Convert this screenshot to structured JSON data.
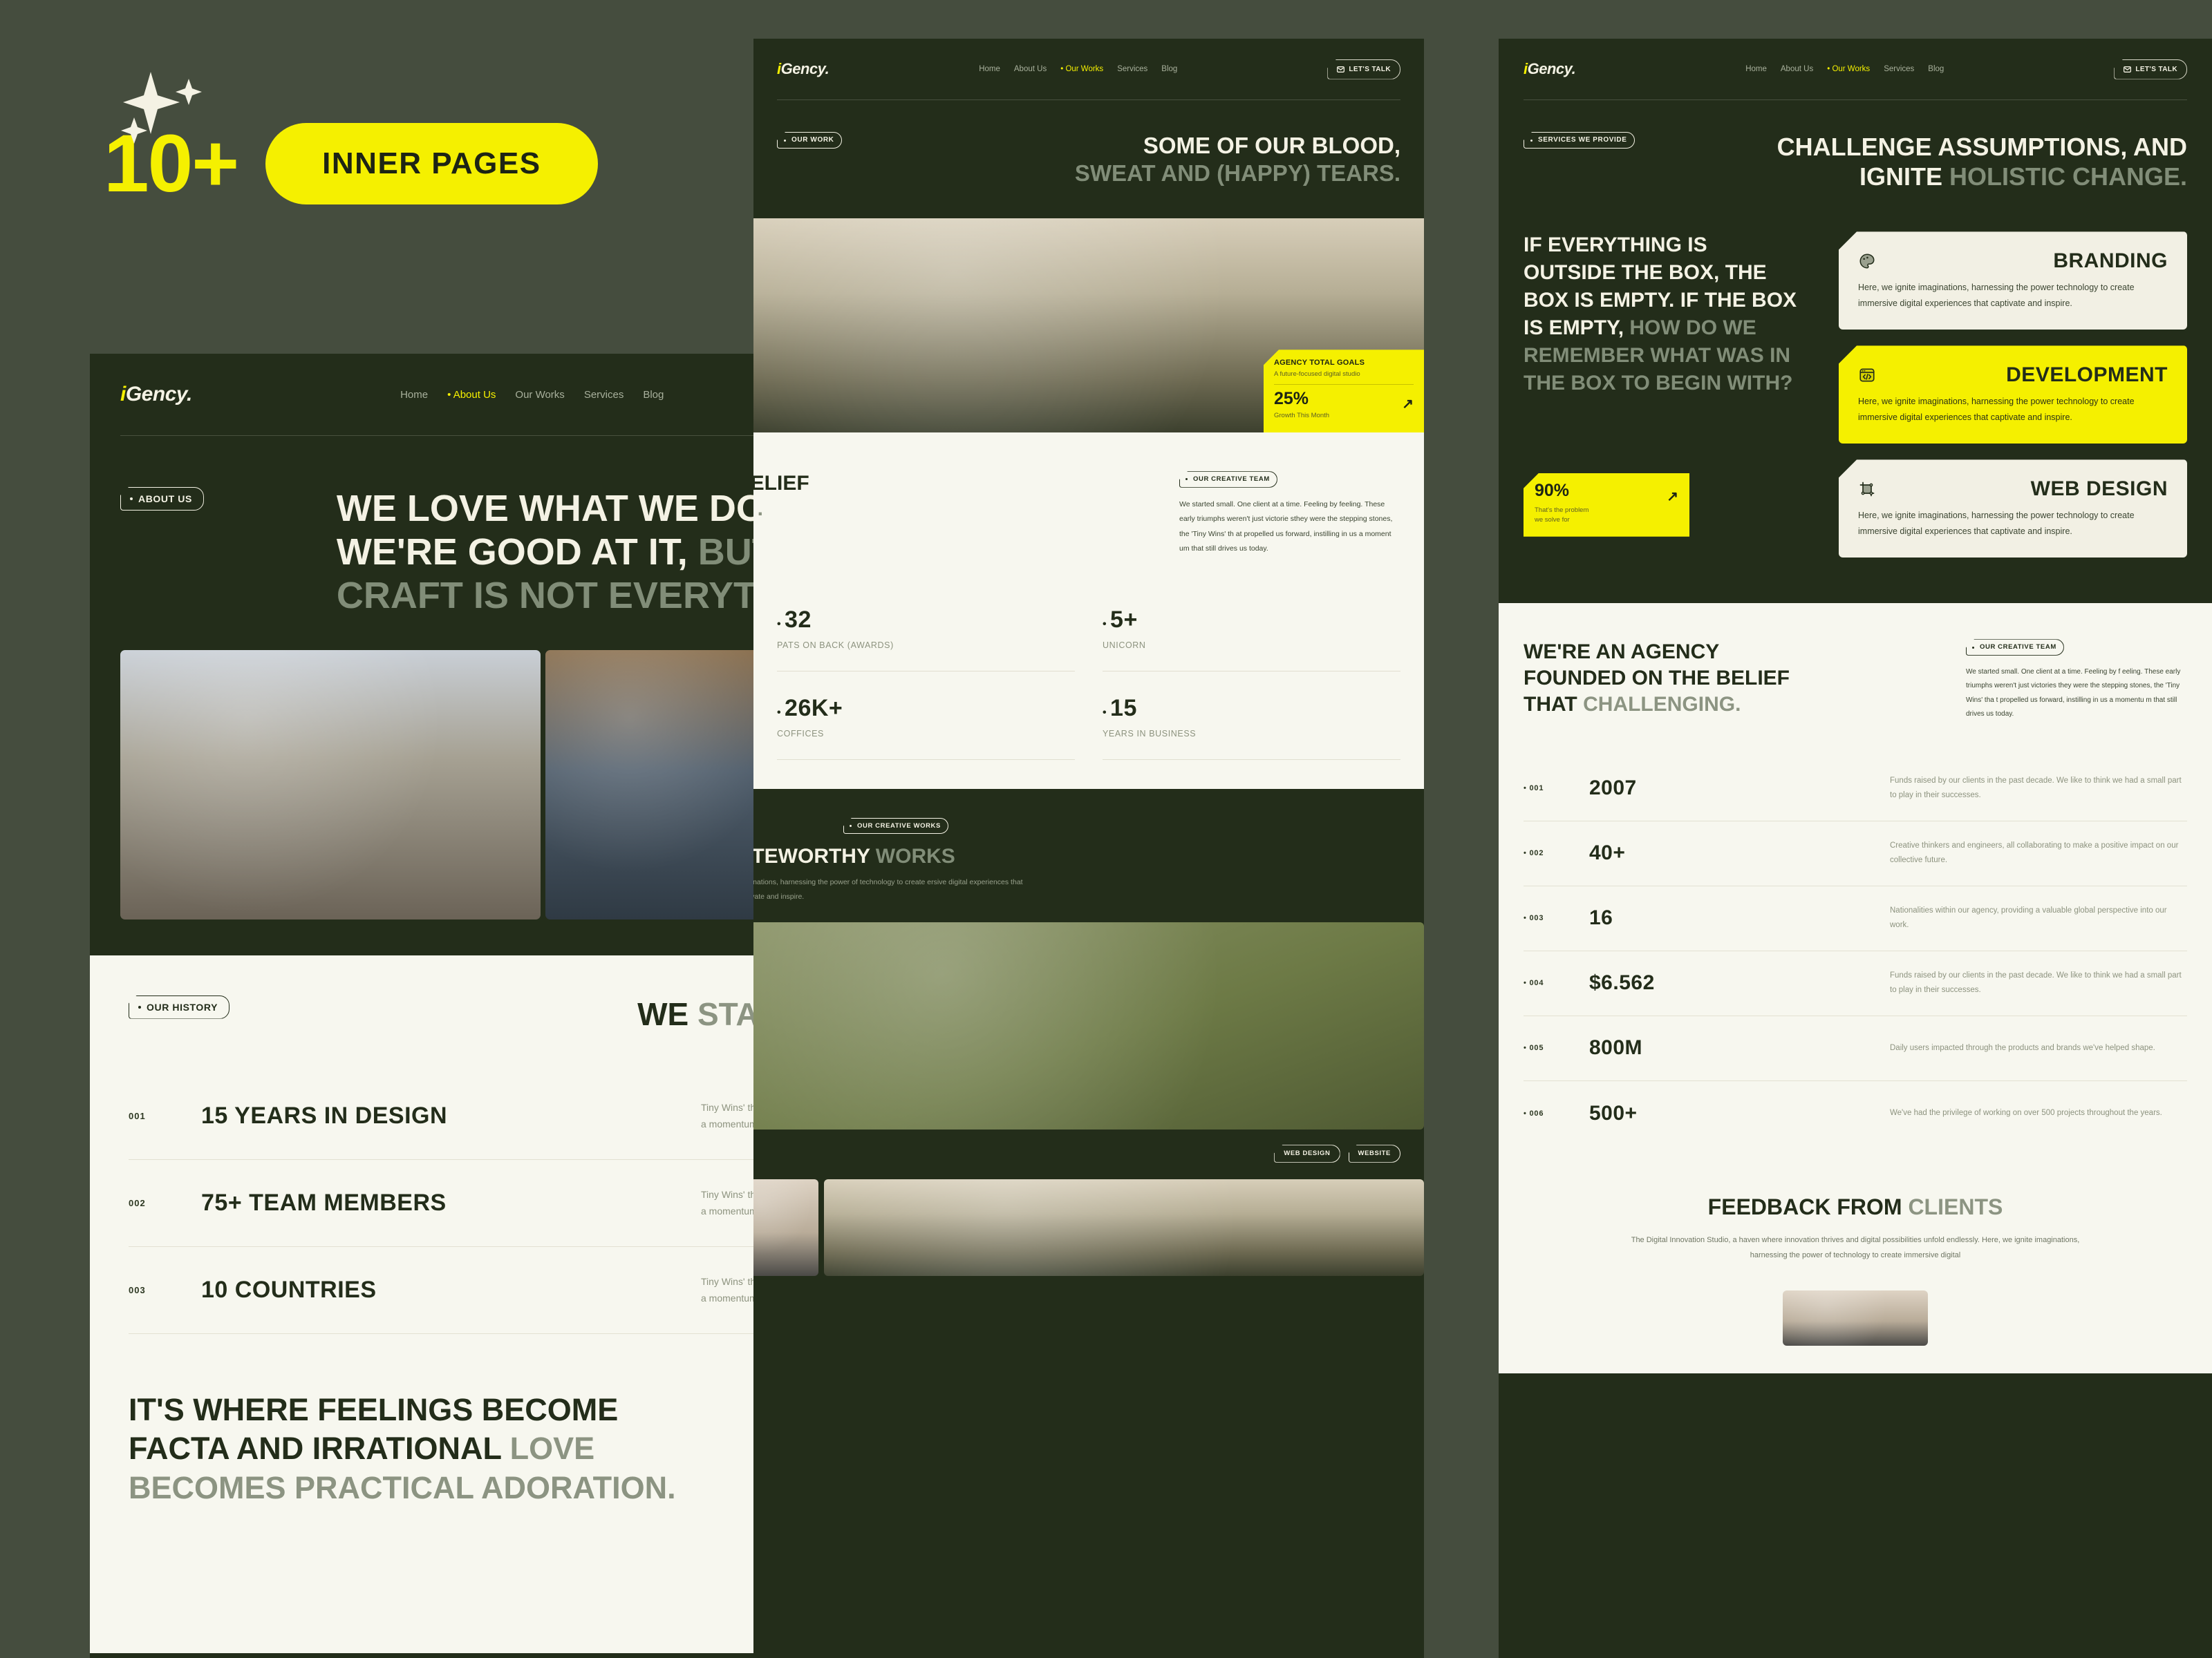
{
  "promo": {
    "count": "10+",
    "label": "INNER PAGES",
    "accent": "#f5f000"
  },
  "brand": {
    "logo_i": "i",
    "logo_rest": "Gency.",
    "cta": "LET'S TALK"
  },
  "nav": [
    "Home",
    "About Us",
    "Our Works",
    "Services",
    "Blog"
  ],
  "colors": {
    "canvas": "#454d3e",
    "panel_dark": "#232d1a",
    "cream": "#f7f7ef",
    "accent": "#f5f000",
    "muted": "#8d937f"
  },
  "about_page": {
    "active_nav": "About Us",
    "badge": "ABOUT US",
    "hero_light": "WE LOVE WHAT WE DO AND WE'RE GOOD AT IT,",
    "hero_muted": "BUT CRAFT IS NOT EVERYTHING.",
    "history_badge": "OUR HISTORY",
    "history_title_dark": "WE",
    "history_title_muted": "STARTED SMALL",
    "history": [
      {
        "idx": "001",
        "title": "15 YEARS IN DESIGN",
        "desc": "Tiny Wins' that propelled us forward instilling in us a momentum.",
        "arrow": "arrow-up-right-icon"
      },
      {
        "idx": "002",
        "title": "75+ TEAM MEMBERS",
        "desc": "Tiny Wins' that propelled us forward instilling in us a momentum.",
        "arrow": "arrow-up-right-icon"
      },
      {
        "idx": "003",
        "title": "10 COUNTRIES",
        "desc": "Tiny Wins' that propelled us forward instilling in us a momentum.",
        "arrow": "arrow-up-right-icon"
      }
    ],
    "closing_dark": "IT'S WHERE FEELINGS BECOME FACTA AND IRRATIONAL",
    "closing_muted": "LOVE BECOMES PRACTICAL ADORATION."
  },
  "works_page": {
    "active_nav": "Our Works",
    "badge": "OUR WORK",
    "hero_light": "SOME OF OUR BLOOD,",
    "hero_muted": "SWEAT AND (HAPPY) TEARS.",
    "goal_card": {
      "title": "AGENCY TOTAL GOALS",
      "subtitle": "A future-focused digital studio",
      "value": "25%",
      "caption": "Growth This Month",
      "arrow": "arrow-up-right-icon"
    },
    "belief_title_dark": "BELIEF",
    "belief_title_muted": "G .",
    "team_badge": "OUR CREATIVE TEAM",
    "team_paragraph": "We started small. One client at a time. Feeling by feeling. These early triumphs weren't just victorie sthey were the stepping stones, the 'Tiny Wins' th at propelled us forward, instilling in us a moment um that still drives us today.",
    "stats": [
      {
        "value": "32",
        "label": "PATS ON BACK (AWARDS)"
      },
      {
        "value": "5+",
        "label": "UNICORN"
      },
      {
        "value": "26K+",
        "label": "COFFICES"
      },
      {
        "value": "15",
        "label": "YEARS IN BUSINESS"
      }
    ],
    "works_badge": "OUR CREATIVE WORKS",
    "works_title_light": "OTEWORTHY",
    "works_title_muted": "WORKS",
    "works_paragraph": " imaginations, harnessing the power of technology to create ersive digital experiences that captivate and inspire.",
    "tags": [
      "WEB DESIGN",
      "WEBSITE"
    ]
  },
  "services_page": {
    "active_nav": "Our Works",
    "badge": "SERVICES WE PROVIDE",
    "hero_light": "CHALLENGE ASSUMPTIONS, AND IGNITE",
    "hero_muted": "HOLISTIC CHANGE.",
    "statement_light": "IF EVERYTHING IS OUTSIDE THE BOX, THE BOX IS EMPTY. IF THE BOX IS EMPTY,",
    "statement_muted": "HOW DO WE REMEMBER WHAT WAS IN THE BOX TO BEGIN WITH?",
    "problem_card": {
      "value": "90%",
      "caption_line1": "That's the problem",
      "caption_line2": "we solve for",
      "arrow": "arrow-up-right-icon"
    },
    "cards": [
      {
        "title": "BRANDING",
        "icon": "palette-icon",
        "body": "Here, we ignite imaginations, harnessing the power technology to create immersive digital experiences that captivate and inspire.",
        "highlight": false
      },
      {
        "title": "DEVELOPMENT",
        "icon": "code-window-icon",
        "body": "Here, we ignite imaginations, harnessing the power technology to create immersive digital experiences that captivate and inspire.",
        "highlight": true
      },
      {
        "title": "WEB DESIGN",
        "icon": "crop-frame-icon",
        "body": "Here, we ignite imaginations, harnessing the power technology to create immersive digital experiences that captivate and inspire.",
        "highlight": false
      }
    ],
    "agency_title_dark": "WE'RE AN AGENCY FOUNDED ON THE BELIEF THAT",
    "agency_title_muted": "CHALLENGING.",
    "team_badge": "OUR CREATIVE TEAM",
    "team_paragraph": "We started small. One client at a time. Feeling by f eeling. These early triumphs weren't just victories they were the stepping stones, the 'Tiny Wins' tha t propelled us forward, instilling in us a momentu m that still drives us today.",
    "stats": [
      {
        "idx": "001",
        "value": "2007",
        "desc": "Funds raised by our clients in the past decade. We like to think we had a small part to play in their successes."
      },
      {
        "idx": "002",
        "value": "40+",
        "desc": "Creative thinkers and engineers, all collaborating to make a positive impact on our collective future."
      },
      {
        "idx": "003",
        "value": "16",
        "desc": "Nationalities within our agency, providing a valuable global perspective into our work."
      },
      {
        "idx": "004",
        "value": "$6.562",
        "desc": "Funds raised by our clients in the past decade. We like to think we had a small part to play in their successes."
      },
      {
        "idx": "005",
        "value": "800M",
        "desc": "Daily users impacted through the products and brands we've helped shape."
      },
      {
        "idx": "006",
        "value": "500+",
        "desc": "We've had the privilege of working on over 500 projects throughout the years."
      }
    ],
    "feedback_title_dark": "FEEDBACK FROM",
    "feedback_title_muted": "CLIENTS",
    "feedback_paragraph": "The Digital Innovation Studio, a haven where innovation thrives and digital possibilities unfold endlessly. Here, we ignite imaginations, harnessing the power of technology to create immersive digital"
  }
}
